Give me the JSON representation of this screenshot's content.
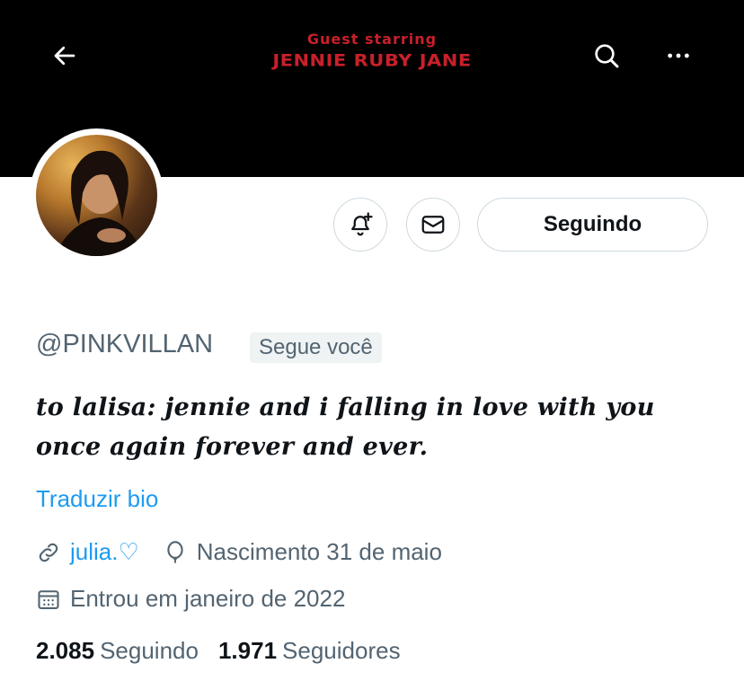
{
  "header": {
    "banner_line1": "Guest starring",
    "banner_line2": "JENNIE RUBY JANE",
    "back_icon": "arrow-left-icon",
    "search_icon": "search-icon",
    "more_icon": "more-horizontal-icon"
  },
  "actions": {
    "notify_icon": "bell-plus-icon",
    "message_icon": "envelope-icon",
    "follow_label": "Seguindo"
  },
  "profile": {
    "handle": "@PINKVILLAN",
    "follows_you": "Segue você",
    "bio": "to lalisa: jennie and i falling in love with you once again forever and ever.",
    "translate_label": "Traduzir bio",
    "link": "julia.♡",
    "birthday": "Nascimento 31 de maio",
    "joined": "Entrou em janeiro de 2022"
  },
  "stats": {
    "following_count": "2.085",
    "following_label": "Seguindo",
    "followers_count": "1.971",
    "followers_label": "Seguidores"
  },
  "colors": {
    "accent": "#1d9bf0",
    "banner_text": "#c8202a",
    "secondary_text": "#536471"
  }
}
